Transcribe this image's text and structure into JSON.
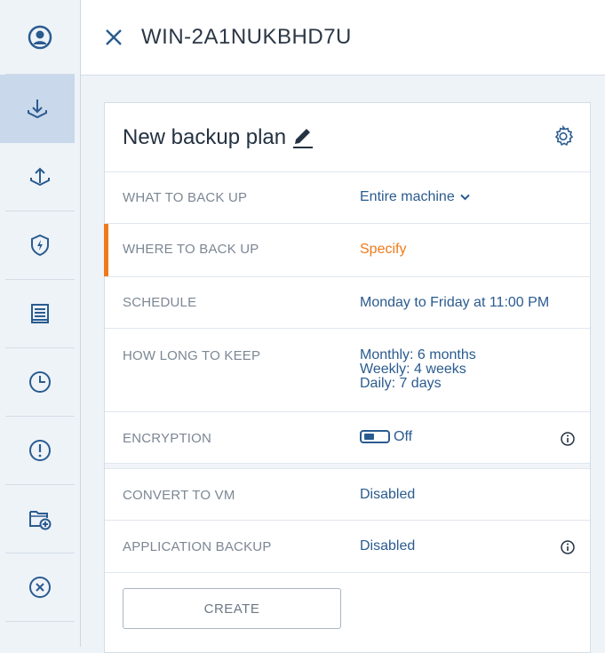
{
  "header": {
    "machine_name": "WIN-2A1NUKBHD7U"
  },
  "sidebar": {
    "items": [
      {
        "icon": "account-icon"
      },
      {
        "icon": "backup-icon",
        "active": true
      },
      {
        "icon": "recovery-icon"
      },
      {
        "icon": "protection-icon"
      },
      {
        "icon": "report-icon"
      },
      {
        "icon": "history-icon"
      },
      {
        "icon": "alert-icon"
      },
      {
        "icon": "add-folder-icon"
      },
      {
        "icon": "remove-icon"
      }
    ]
  },
  "plan": {
    "title": "New backup plan",
    "rows": {
      "what": {
        "label": "WHAT TO BACK UP",
        "value": "Entire machine"
      },
      "where": {
        "label": "WHERE TO BACK UP",
        "value": "Specify"
      },
      "schedule": {
        "label": "SCHEDULE",
        "value": "Monday to Friday at 11:00 PM"
      },
      "retention": {
        "label": "HOW LONG TO KEEP",
        "line1": "Monthly: 6 months",
        "line2": "Weekly: 4 weeks",
        "line3": "Daily: 7 days"
      },
      "encryption": {
        "label": "ENCRYPTION",
        "value": "Off"
      },
      "convert": {
        "label": "CONVERT TO VM",
        "value": "Disabled"
      },
      "application": {
        "label": "APPLICATION BACKUP",
        "value": "Disabled"
      }
    },
    "create_label": "CREATE"
  },
  "colors": {
    "accent": "#2a5b8f",
    "warning": "#f07a1a",
    "label": "#7b8794"
  }
}
